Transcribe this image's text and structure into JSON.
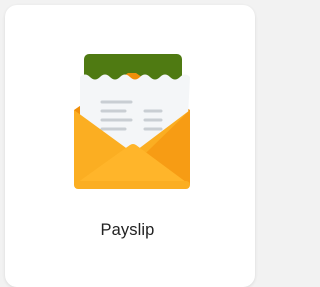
{
  "tile": {
    "label": "Payslip"
  },
  "icon": {
    "name": "payslip-envelope-icon",
    "colors": {
      "card_green": "#4f7a12",
      "paper": "#f4f6f8",
      "paper_lines": "#c9ced3",
      "envelope_back": "#f59a0e",
      "envelope_front_left": "#fbb027",
      "envelope_front_right": "#f7a21a",
      "envelope_flap": "#ffcb4d"
    }
  }
}
